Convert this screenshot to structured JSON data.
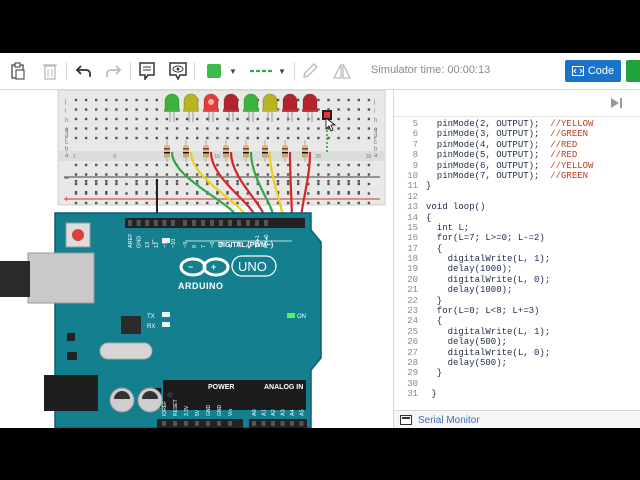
{
  "toolbar": {
    "icons": [
      "clipboard-icon",
      "trash-icon",
      "undo-icon",
      "redo-icon",
      "note-icon",
      "visibility-icon",
      "color-swatch-icon",
      "dropdown-icon",
      "line-style-icon",
      "dropdown-icon",
      "pencil-icon",
      "flip-icon"
    ],
    "swatch_color": "#3dbb4e",
    "simulator_time": "Simulator time: 00:00:13",
    "code_label": "Code",
    "start_color": "#1fa33a",
    "accent": "#1a73c8"
  },
  "breadboard": {
    "row_letters_top": [
      "j",
      "i",
      "h",
      "g",
      "f"
    ],
    "row_letters_bottom": [
      "e",
      "d",
      "c",
      "b",
      "a"
    ],
    "column_numbers": [
      "1",
      "",
      "",
      "",
      "5",
      "",
      "",
      "",
      "",
      "10",
      "",
      "",
      "",
      "",
      "15",
      "",
      "",
      "",
      "",
      "20",
      "",
      "",
      "",
      "",
      "25",
      "",
      "",
      "",
      "",
      "30"
    ],
    "rail_plus": "+",
    "rail_minus": "−"
  },
  "leds": [
    {
      "color": "#3cb33a",
      "state": "off"
    },
    {
      "color": "#b9b51f",
      "state": "off"
    },
    {
      "color": "#e63b3b",
      "state": "on"
    },
    {
      "color": "#b5232a",
      "state": "off"
    },
    {
      "color": "#3cb33a",
      "state": "off"
    },
    {
      "color": "#b9b51f",
      "state": "off"
    },
    {
      "color": "#b5232a",
      "state": "off"
    },
    {
      "color": "#b5232a",
      "state": "off"
    }
  ],
  "arduino": {
    "brand": "ARDUINO",
    "model": "UNO",
    "digital_label": "DIGITAL (PWM~)",
    "power_label": "POWER",
    "analog_label": "ANALOG IN",
    "on_label": "ON",
    "l_label": "L",
    "tx_label": "TX",
    "rx_label": "RX",
    "top_pins": [
      "AREF",
      "GND",
      "13",
      "12",
      "~11",
      "~10",
      "~9",
      "8",
      "7",
      "~6",
      "~5",
      "4",
      "~3",
      "2",
      "TX▸1",
      "RX◂0"
    ],
    "power_pins": [
      "IOREF",
      "RESET",
      "3.3V",
      "5V",
      "GND",
      "GND",
      "Vin"
    ],
    "analog_pins": [
      "A0",
      "A1",
      "A2",
      "A3",
      "A4",
      "A5"
    ]
  },
  "code": {
    "lines": [
      {
        "n": "5",
        "text": "  pinMode(2, OUTPUT);  ",
        "comment": "//YELLOW"
      },
      {
        "n": "6",
        "text": "  pinMode(3, OUTPUT);  ",
        "comment": "//GREEN"
      },
      {
        "n": "7",
        "text": "  pinMode(4, OUTPUT);  ",
        "comment": "//RED"
      },
      {
        "n": "8",
        "text": "  pinMode(5, OUTPUT);  ",
        "comment": "//RED"
      },
      {
        "n": "9",
        "text": "  pinMode(6, OUTPUT);  ",
        "comment": "//YELLOW"
      },
      {
        "n": "10",
        "text": "  pinMode(7, OUTPUT);  ",
        "comment": "//GREEN"
      },
      {
        "n": "11",
        "text": "}",
        "comment": ""
      },
      {
        "n": "12",
        "text": "",
        "comment": ""
      },
      {
        "n": "13",
        "text": "void loop()",
        "comment": ""
      },
      {
        "n": "14",
        "text": "{",
        "comment": ""
      },
      {
        "n": "15",
        "text": "  int L;",
        "comment": ""
      },
      {
        "n": "16",
        "text": "  for(L=7; L>=0; L-=2)",
        "comment": ""
      },
      {
        "n": "17",
        "text": "  {",
        "comment": ""
      },
      {
        "n": "18",
        "text": "    digitalWrite(L, 1);",
        "comment": ""
      },
      {
        "n": "19",
        "text": "    delay(1000);",
        "comment": ""
      },
      {
        "n": "20",
        "text": "    digitalWrite(L, 0);",
        "comment": ""
      },
      {
        "n": "21",
        "text": "    delay(1000);",
        "comment": ""
      },
      {
        "n": "22",
        "text": "  }",
        "comment": ""
      },
      {
        "n": "23",
        "text": "  for(L=0; L<8; L+=3)",
        "comment": ""
      },
      {
        "n": "24",
        "text": "  {",
        "comment": ""
      },
      {
        "n": "25",
        "text": "    digitalWrite(L, 1);",
        "comment": ""
      },
      {
        "n": "26",
        "text": "    delay(500);",
        "comment": ""
      },
      {
        "n": "27",
        "text": "    digitalWrite(L, 0);",
        "comment": ""
      },
      {
        "n": "28",
        "text": "    delay(500);",
        "comment": ""
      },
      {
        "n": "29",
        "text": "  }",
        "comment": ""
      },
      {
        "n": "30",
        "text": "",
        "comment": ""
      },
      {
        "n": "31",
        "text": " }",
        "comment": ""
      }
    ],
    "serial_monitor": "Serial Monitor"
  }
}
